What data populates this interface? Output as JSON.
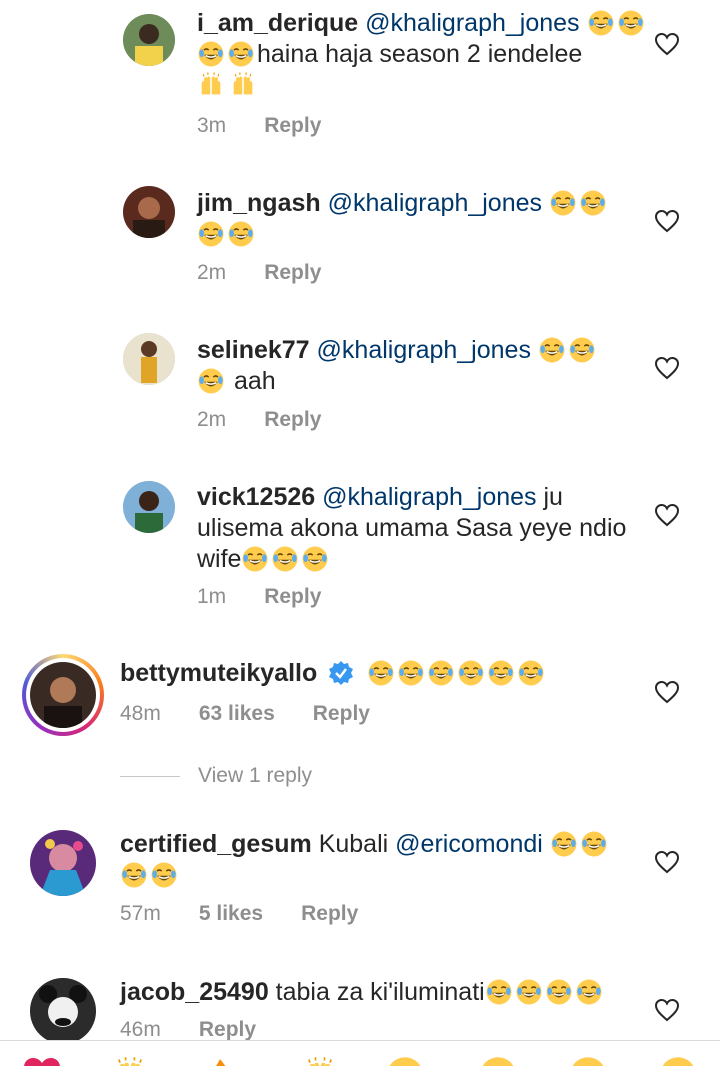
{
  "replies": [
    {
      "username": "i_am_derique",
      "mention": "@khaligraph_jones",
      "text": "haina haja season 2 iendelee",
      "time": "3m",
      "reply_label": "Reply",
      "avatar_icon": "avatar-photo"
    },
    {
      "username": "jim_ngash",
      "mention": "@khaligraph_jones",
      "text": "",
      "time": "2m",
      "reply_label": "Reply",
      "avatar_icon": "avatar-photo"
    },
    {
      "username": "selinek77",
      "mention": "@khaligraph_jones",
      "text": "aah",
      "time": "2m",
      "reply_label": "Reply",
      "avatar_icon": "avatar-photo"
    },
    {
      "username": "vick12526",
      "mention": "@khaligraph_jones",
      "text": "ju ulisema akona umama Sasa yeye ndio wife",
      "time": "1m",
      "reply_label": "Reply",
      "avatar_icon": "avatar-photo"
    }
  ],
  "comments": [
    {
      "username": "bettymuteikyallo",
      "verified": true,
      "time": "48m",
      "likes": "63 likes",
      "reply_label": "Reply",
      "view_replies": "View 1 reply"
    },
    {
      "username": "certified_gesum",
      "text": "Kubali",
      "mention": "@ericomondi",
      "time": "57m",
      "likes": "5 likes",
      "reply_label": "Reply"
    },
    {
      "username": "jacob_25490",
      "text": "tabia za  ki'iluminati",
      "time": "46m",
      "reply_label": "Reply"
    }
  ],
  "colors": {
    "text": "#262626",
    "mention": "#00376b",
    "meta": "#8e8e8e",
    "verified": "#3897f0",
    "emoji_face": "#ffcc4d"
  }
}
